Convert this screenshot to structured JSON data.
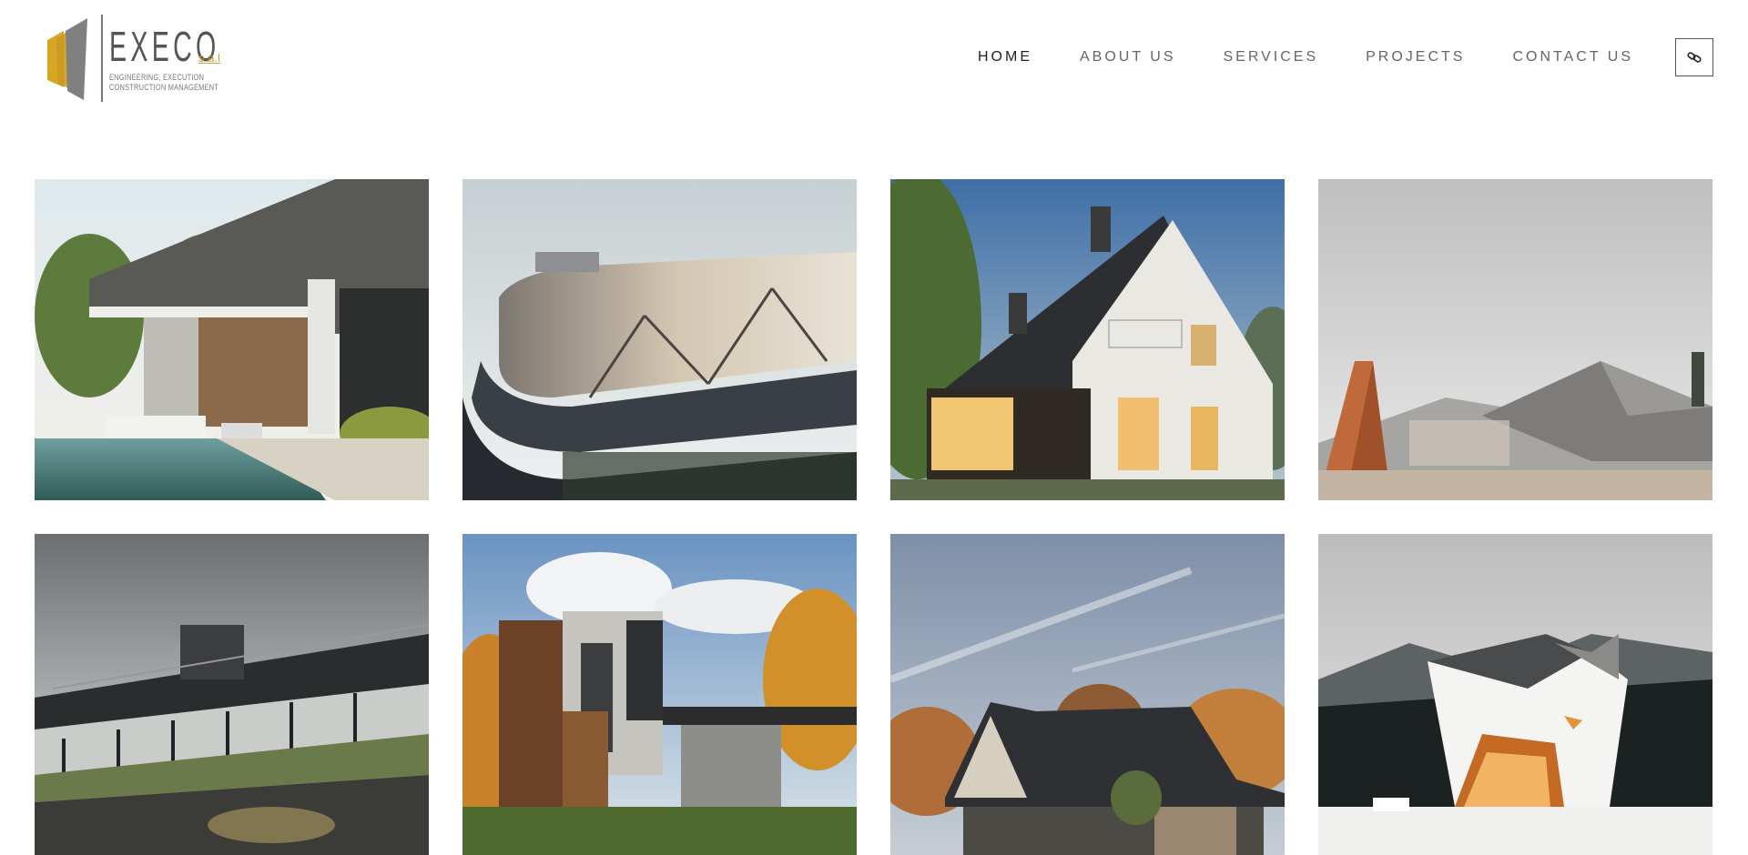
{
  "brand": {
    "name": "EXECO",
    "suffix": "s.a.l",
    "tagline_1": "ENGINEERING, EXECUTION",
    "tagline_2": "CONSTRUCTION MANAGEMENT",
    "colors": {
      "gold": "#d7a623",
      "gray": "#6f6f6f"
    }
  },
  "nav": {
    "items": [
      {
        "label": "HOME",
        "active": true
      },
      {
        "label": "ABOUT US",
        "active": false
      },
      {
        "label": "SERVICES",
        "active": false
      },
      {
        "label": "PROJECTS",
        "active": false
      },
      {
        "label": "CONTACT US",
        "active": false
      }
    ],
    "menu_icon": "link-icon"
  },
  "projects": [
    {
      "name": "modern-villa-pool",
      "icon": "photo"
    },
    {
      "name": "futuristic-curved-building",
      "icon": "photo"
    },
    {
      "name": "gabled-white-house",
      "icon": "photo"
    },
    {
      "name": "angular-concrete-building",
      "icon": "photo"
    },
    {
      "name": "horizontal-glass-building",
      "icon": "photo"
    },
    {
      "name": "wood-stone-house-autumn",
      "icon": "photo"
    },
    {
      "name": "dark-roof-house",
      "icon": "photo"
    },
    {
      "name": "angular-white-house-mountains",
      "icon": "photo"
    }
  ]
}
